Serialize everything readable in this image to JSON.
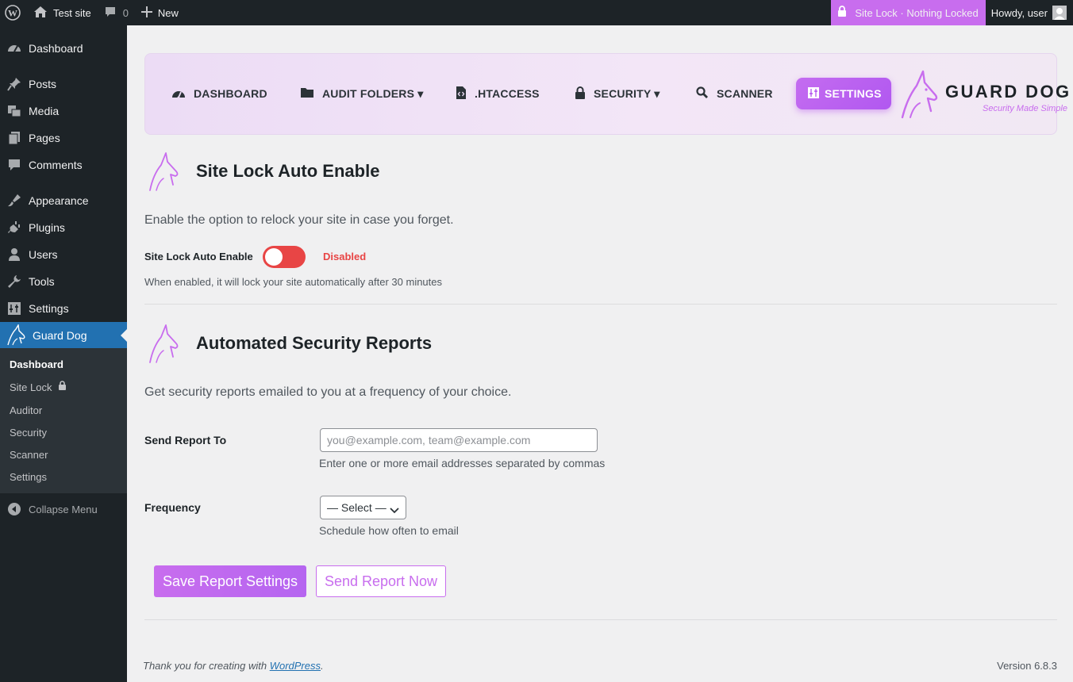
{
  "adminbar": {
    "site_name": "Test site",
    "comments_count": "0",
    "new_label": "New",
    "site_lock_status": "Site Lock · Nothing Locked",
    "howdy": "Howdy, user"
  },
  "sidebar": {
    "items": [
      {
        "label": "Dashboard",
        "icon": "dashboard-icon"
      },
      {
        "label": "Posts",
        "icon": "pin-icon"
      },
      {
        "label": "Media",
        "icon": "media-icon"
      },
      {
        "label": "Pages",
        "icon": "pages-icon"
      },
      {
        "label": "Comments",
        "icon": "comment-icon"
      },
      {
        "label": "Appearance",
        "icon": "brush-icon"
      },
      {
        "label": "Plugins",
        "icon": "plugin-icon"
      },
      {
        "label": "Users",
        "icon": "user-icon"
      },
      {
        "label": "Tools",
        "icon": "wrench-icon"
      },
      {
        "label": "Settings",
        "icon": "settings-icon"
      },
      {
        "label": "Guard Dog",
        "icon": "guard-dog-icon"
      }
    ],
    "submenu": [
      "Dashboard",
      "Site Lock",
      "Auditor",
      "Security",
      "Scanner",
      "Settings"
    ],
    "collapse_label": "Collapse Menu"
  },
  "nav": {
    "tabs": [
      "DASHBOARD",
      "AUDIT FOLDERS ▾",
      ".HTACCESS",
      "SECURITY ▾",
      "SCANNER",
      "SETTINGS"
    ],
    "active_tab": "SETTINGS",
    "logo_name": "GUARD DOG",
    "logo_tagline": "Security Made Simple"
  },
  "sitelock": {
    "title": "Site Lock Auto Enable",
    "description": "Enable the option to relock your site in case you forget.",
    "toggle_label": "Site Lock Auto Enable",
    "toggle_state": "Disabled",
    "help": "When enabled, it will lock your site automatically after 30 minutes"
  },
  "reports": {
    "title": "Automated Security Reports",
    "description": "Get security reports emailed to you at a frequency of your choice.",
    "send_to_label": "Send Report To",
    "email_placeholder": "you@example.com, team@example.com",
    "email_value": "",
    "email_help": "Enter one or more email addresses separated by commas",
    "frequency_label": "Frequency",
    "frequency_selected": "— Select —",
    "frequency_help": "Schedule how often to email",
    "save_button": "Save Report Settings",
    "send_button": "Send Report Now"
  },
  "footer": {
    "thanks_prefix": "Thank you for creating with ",
    "thanks_link": "WordPress",
    "thanks_suffix": ".",
    "version": "Version 6.8.3"
  },
  "colors": {
    "accent": "#c86dee",
    "wp_admin_dark": "#1d2327",
    "wp_blue": "#2271b1",
    "toggle_off": "#e84545"
  }
}
